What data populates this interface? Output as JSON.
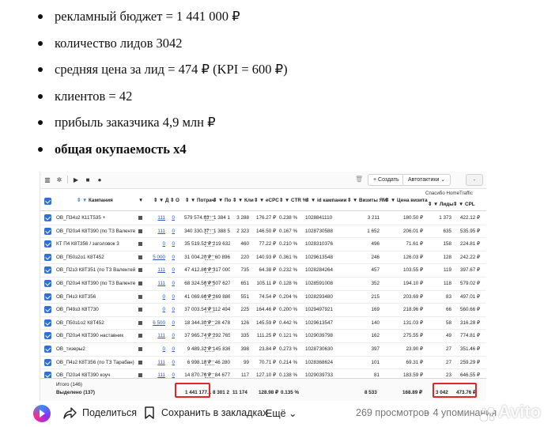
{
  "bullets": [
    "рекламный бюджет = 1 441 000 ₽",
    "количество лидов 3042",
    "средняя цена за лид = 474 ₽ (KPI = 600 ₽)",
    "клиентов = 42",
    "прибыль заказчика 4,9 млн ₽",
    "общая окупаемость х4"
  ],
  "toolbar": {
    "create_label": "+ Создать",
    "auto_label": "Автотактики ⌄",
    "minus_label": "-"
  },
  "group_header": "Спасибо HomeTraffic",
  "columns": {
    "campaign": "Кампания",
    "d": "Д",
    "o": "О",
    "spend": "Потрач",
    "po": "По",
    "kl": "Кли",
    "ecpc": "eCPC",
    "ctr": "CTR %",
    "id": "id кампании",
    "visits": "Визиты ЯМ",
    "visit_price": "Цена визита",
    "leads": "Лиды",
    "cpl": "CPL"
  },
  "rows": [
    {
      "name": "ОВ_П34з2 К11Т535 +",
      "d": "111",
      "o": "0",
      "spend": "579 574.63 ₽",
      "po": "1 384 1",
      "kl": "3 288",
      "ecpc": "176.27 ₽",
      "ctr": "0.238 %",
      "id": "1028841110",
      "visits": "3 211",
      "vp": "180.50 ₽",
      "leads": "1 373",
      "cpl": "422.12 ₽"
    },
    {
      "name": "ОВ_П20з4 К8Т390 (по ТЗ Валентей)",
      "d": "111",
      "o": "0",
      "spend": "340 330.37 ₽",
      "po": "1 388 5",
      "kl": "2 323",
      "ecpc": "146.50 ₽",
      "ctr": "0.167 %",
      "id": "1028730588",
      "visits": "1 652",
      "vp": "206.01 ₽",
      "leads": "635",
      "cpl": "535.95 ₽"
    },
    {
      "name": "КТ П4 К8Т356 / заголовок 3",
      "d": "0",
      "o": "0",
      "spend": "35 519.52 ₽",
      "po": "219 632",
      "kl": "460",
      "ecpc": "77.22 ₽",
      "ctr": "0.210 %",
      "id": "1028310376",
      "visits": "496",
      "vp": "71.61 ₽",
      "leads": "158",
      "cpl": "224.81 ₽"
    },
    {
      "name": "ОВ_П50з2о1 К8Т452",
      "d": "5 000",
      "o": "0",
      "spend": "31 004.20 ₽",
      "po": "60 896",
      "kl": "220",
      "ecpc": "140.93 ₽",
      "ctr": "0.361 %",
      "id": "1029613548",
      "visits": "246",
      "vp": "126.03 ₽",
      "leads": "128",
      "cpl": "242.22 ₽"
    },
    {
      "name": "ОВ_П2з3 К8Т351 (по ТЗ Валентей)",
      "d": "111",
      "o": "0",
      "spend": "47 412.86 ₽",
      "po": "317 000",
      "kl": "735",
      "ecpc": "64.38 ₽",
      "ctr": "0.232 %",
      "id": "1028284264",
      "visits": "457",
      "vp": "103.55 ₽",
      "leads": "119",
      "cpl": "397.67 ₽"
    },
    {
      "name": "ОВ_П20з4 К8Т390 (по ТЗ Валентей)",
      "d": "111",
      "o": "0",
      "spend": "68 324.56 ₽",
      "po": "507 627",
      "kl": "651",
      "ecpc": "105.11 ₽",
      "ctr": "0.128 %",
      "id": "1028591008",
      "visits": "352",
      "vp": "194.10 ₽",
      "leads": "118",
      "cpl": "579.02 ₽"
    },
    {
      "name": "ОВ_П4з3 К8Т356",
      "d": "0",
      "o": "0",
      "spend": "41 069.66 ₽",
      "po": "269 886",
      "kl": "551",
      "ecpc": "74.54 ₽",
      "ctr": "0.204 %",
      "id": "1028293480",
      "visits": "215",
      "vp": "203.69 ₽",
      "leads": "83",
      "cpl": "497.01 ₽"
    },
    {
      "name": "ОВ_П49з3 К8Т730",
      "d": "0",
      "o": "0",
      "spend": "37 003.54 ₽",
      "po": "112 494",
      "kl": "225",
      "ecpc": "164.46 ₽",
      "ctr": "0.200 %",
      "id": "1029497921",
      "visits": "169",
      "vp": "218.96 ₽",
      "leads": "66",
      "cpl": "560.66 ₽"
    },
    {
      "name": "ОВ_П50з1о2 К8Т452",
      "d": "6 500",
      "o": "0",
      "spend": "18 344.30 ₽",
      "po": "28 478",
      "kl": "126",
      "ecpc": "145.59 ₽",
      "ctr": "0.442 %",
      "id": "1029613547",
      "visits": "140",
      "vp": "131.03 ₽",
      "leads": "58",
      "cpl": "316.28 ₽"
    },
    {
      "name": "ОВ_П20з4 К8Т390 наставник",
      "d": "111",
      "o": "0",
      "spend": "37 965.74 ₽",
      "po": "292 765",
      "kl": "335",
      "ecpc": "111.25 ₽",
      "ctr": "0.121 %",
      "id": "1029039798",
      "visits": "162",
      "vp": "275.55 ₽",
      "leads": "49",
      "cpl": "774.81 ₽"
    },
    {
      "name": "ОВ_тизеры2",
      "d": "0",
      "o": "0",
      "spend": "9 489.32 ₽",
      "po": "145 836",
      "kl": "398",
      "ecpc": "23.84 ₽",
      "ctr": "0.273 %",
      "id": "1028730630",
      "visits": "397",
      "vp": "23.90 ₽",
      "leads": "27",
      "cpl": "351.46 ₽"
    },
    {
      "name": "ОВ_П4з2 К8Т356 (по ТЗ Тарабан) с",
      "d": "111",
      "o": "0",
      "spend": "6 998.18 ₽",
      "po": "46 280",
      "kl": "99",
      "ecpc": "70.71 ₽",
      "ctr": "0.214 %",
      "id": "1028368624",
      "visits": "101",
      "vp": "69.31 ₽",
      "leads": "27",
      "cpl": "259.29 ₽"
    },
    {
      "name": "ОВ_П20з4 К8Т390 коуч",
      "d": "111",
      "o": "0",
      "spend": "14 870.76 ₽",
      "po": "84 677",
      "kl": "117",
      "ecpc": "127.10 ₽",
      "ctr": "0.138 %",
      "id": "1029039733",
      "visits": "81",
      "vp": "183.59 ₽",
      "leads": "23",
      "cpl": "646.55 ₽"
    }
  ],
  "footer": {
    "total_label": "Итого (146)",
    "selected_label": "Выделено (137)",
    "spend": "1 441 177.1",
    "po": "8 301 2",
    "kl": "11 174",
    "ecpc": "128.98 ₽",
    "ctr": "0.135 %",
    "visits": "8 533",
    "vp": "168.89 ₽",
    "leads": "3 042",
    "cpl": "473.76 ₽"
  },
  "actions": {
    "share": "Поделиться",
    "bookmark": "Сохранить в закладках",
    "more": "Ещё ⌄",
    "views": "269 просмотров",
    "mentions": "· 4 упоминания"
  },
  "watermark": "Avito",
  "colors": {
    "accent": "#2f6fd6",
    "highlight": "#e0262a",
    "link": "#2a55c0"
  }
}
